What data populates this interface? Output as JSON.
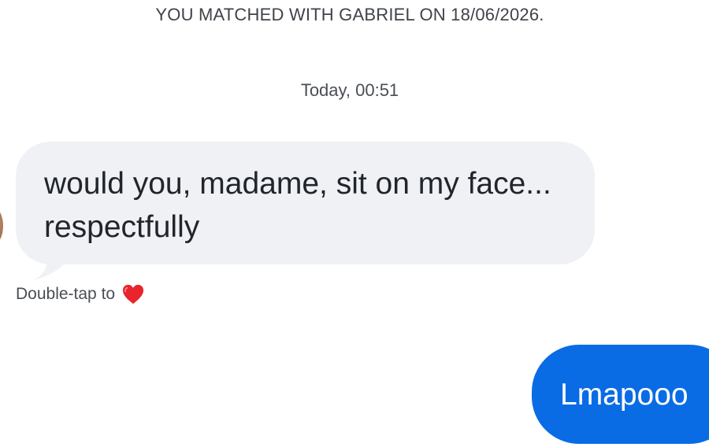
{
  "conversation": {
    "match_banner": "YOU MATCHED WITH GABRIEL ON 18/06/2026.",
    "timestamp": "Today, 00:51",
    "messages": [
      {
        "direction": "incoming",
        "text": "would you, madame, sit on my face...\nrespectfully",
        "hint_text": "Double-tap to",
        "hint_icon": "heart-icon"
      },
      {
        "direction": "outgoing",
        "text": "Lmapooo"
      }
    ]
  },
  "colors": {
    "incoming_bubble": "#f0f1f4",
    "outgoing_bubble": "#0a6ce4",
    "heart": "#e8242c"
  }
}
